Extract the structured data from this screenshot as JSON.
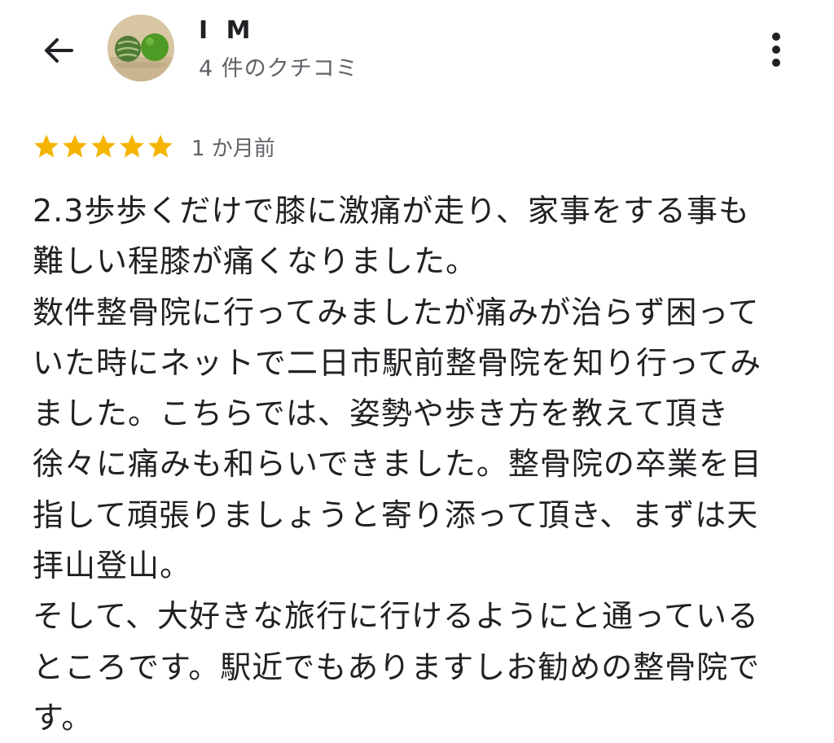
{
  "header": {
    "back_icon": "arrow-left-icon",
    "user_name": "I M",
    "review_count": "4 件のクチコミ",
    "more_icon": "more-vertical-icon"
  },
  "review": {
    "rating": 5,
    "star_color": "#f4b400",
    "time_ago": "1 か月前",
    "text": "2.3歩歩くだけで膝に激痛が走り、家事をする事も\n難しい程膝が痛くなりました。\n数件整骨院に行ってみましたが痛みが治らず困って\nいた時にネットで二日市駅前整骨院を知り行ってみ\nました。こちらでは、姿勢や歩き方を教えて頂き\n徐々に痛みも和らいできました。整骨院の卒業を目\n指して頑張りましょうと寄り添って頂き、まずは天\n拝山登山。\nそして、大好きな旅行に行けるようにと通っている\nところです。駅近でもありますしお勧めの整骨院で\nす。"
  }
}
